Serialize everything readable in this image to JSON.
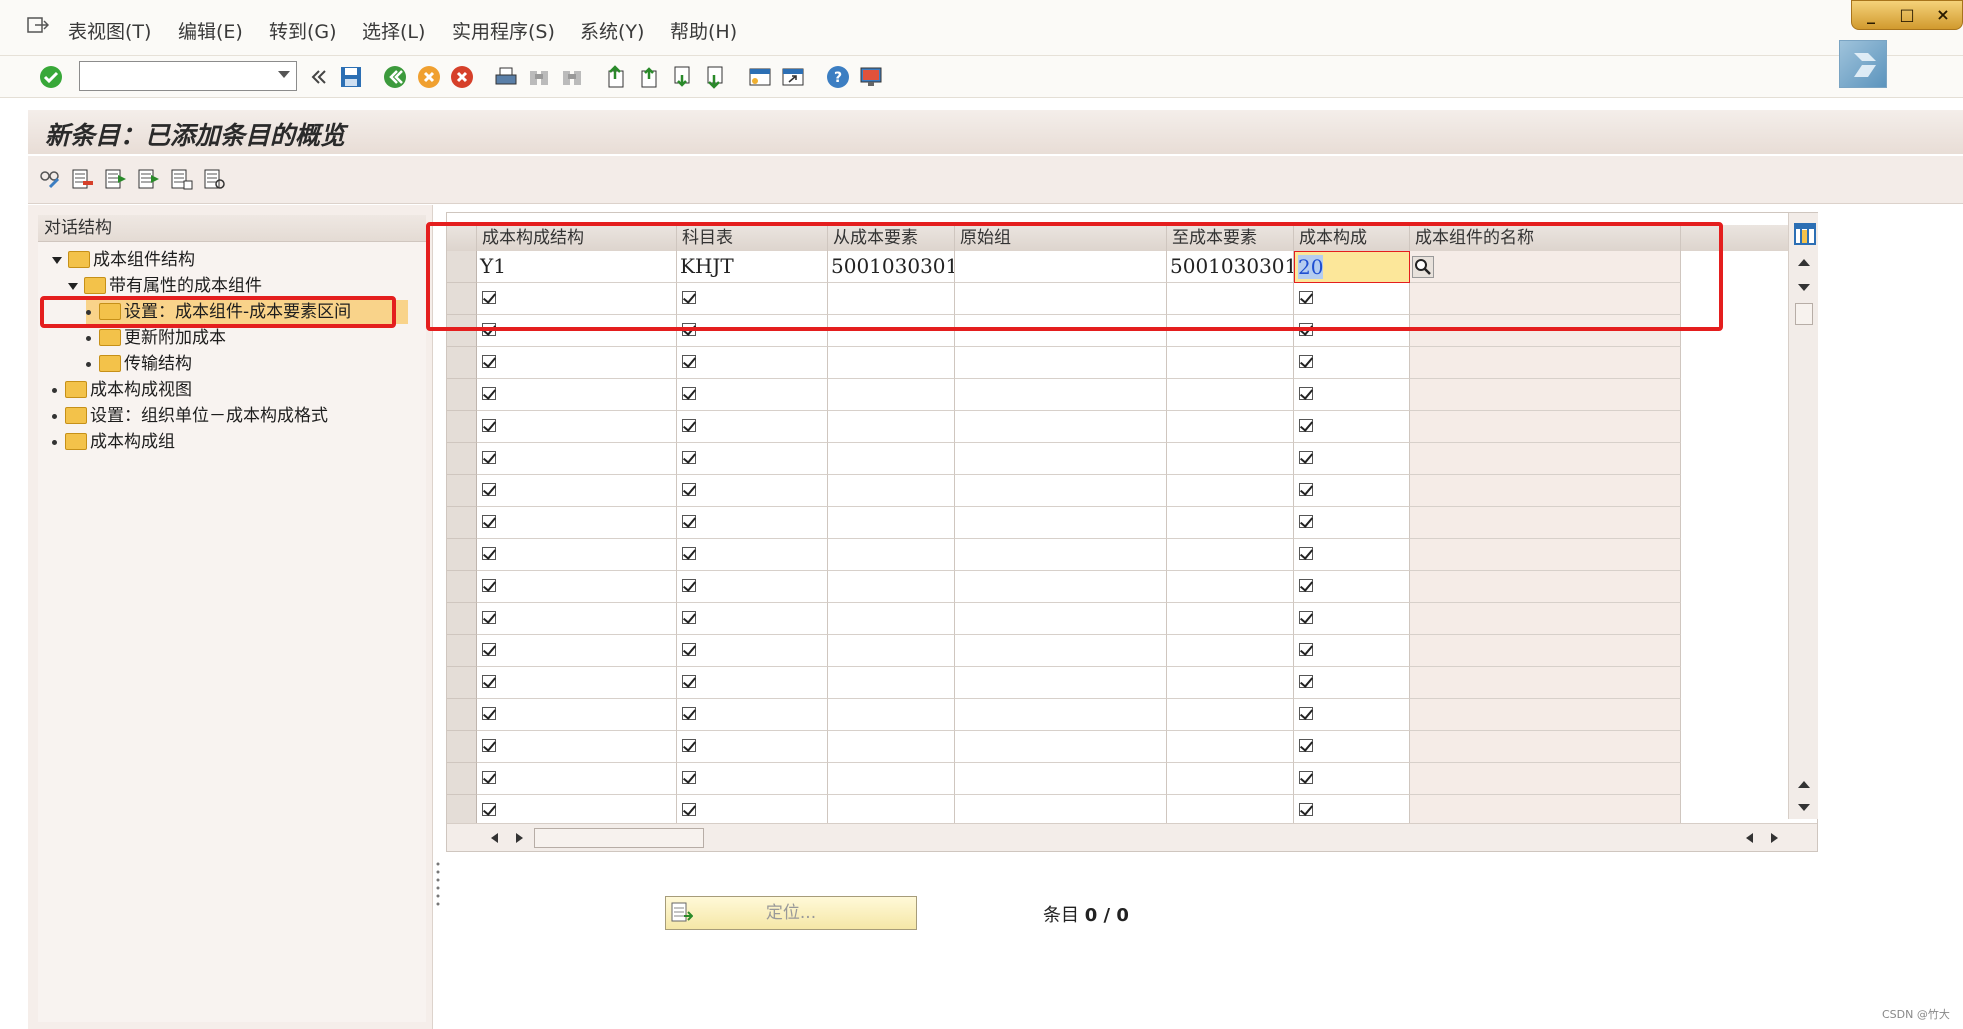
{
  "menubar": {
    "items": [
      "表视图(T)",
      "编辑(E)",
      "转到(G)",
      "选择(L)",
      "实用程序(S)",
      "系统(Y)",
      "帮助(H)"
    ]
  },
  "toolbar": {
    "command_field": {
      "value": "",
      "placeholder": ""
    }
  },
  "title": "新条目：已添加条目的概览",
  "tree": {
    "header": "对话结构",
    "nodes": [
      {
        "label": "成本组件结构"
      },
      {
        "label": "带有属性的成本组件"
      },
      {
        "label": "设置：成本组件-成本要素区间"
      },
      {
        "label": "更新附加成本"
      },
      {
        "label": "传输结构"
      },
      {
        "label": "成本构成视图"
      },
      {
        "label": "设置：组织单位－成本构成格式"
      },
      {
        "label": "成本构成组"
      }
    ]
  },
  "table": {
    "columns": [
      "成本构成结构",
      "科目表",
      "从成本要素",
      "原始组",
      "至成本要素",
      "成本构成",
      "成本组件的名称"
    ],
    "first_row": {
      "cost_comp_structure": "Y1",
      "chart_of_accounts": "KHJT",
      "from_cost_element": "5001030301",
      "origin_group": "",
      "to_cost_element": "5001030301",
      "cost_component": "20",
      "cost_component_name": ""
    }
  },
  "footer": {
    "locate_button": "定位...",
    "entry_label": "条目",
    "entry_count": "0 / 0"
  },
  "watermark": "CSDN @竹大",
  "colors": {
    "highlight_red": "#e41e1e",
    "selected_node": "#f9d38a",
    "input_focus": "#fce79a"
  }
}
